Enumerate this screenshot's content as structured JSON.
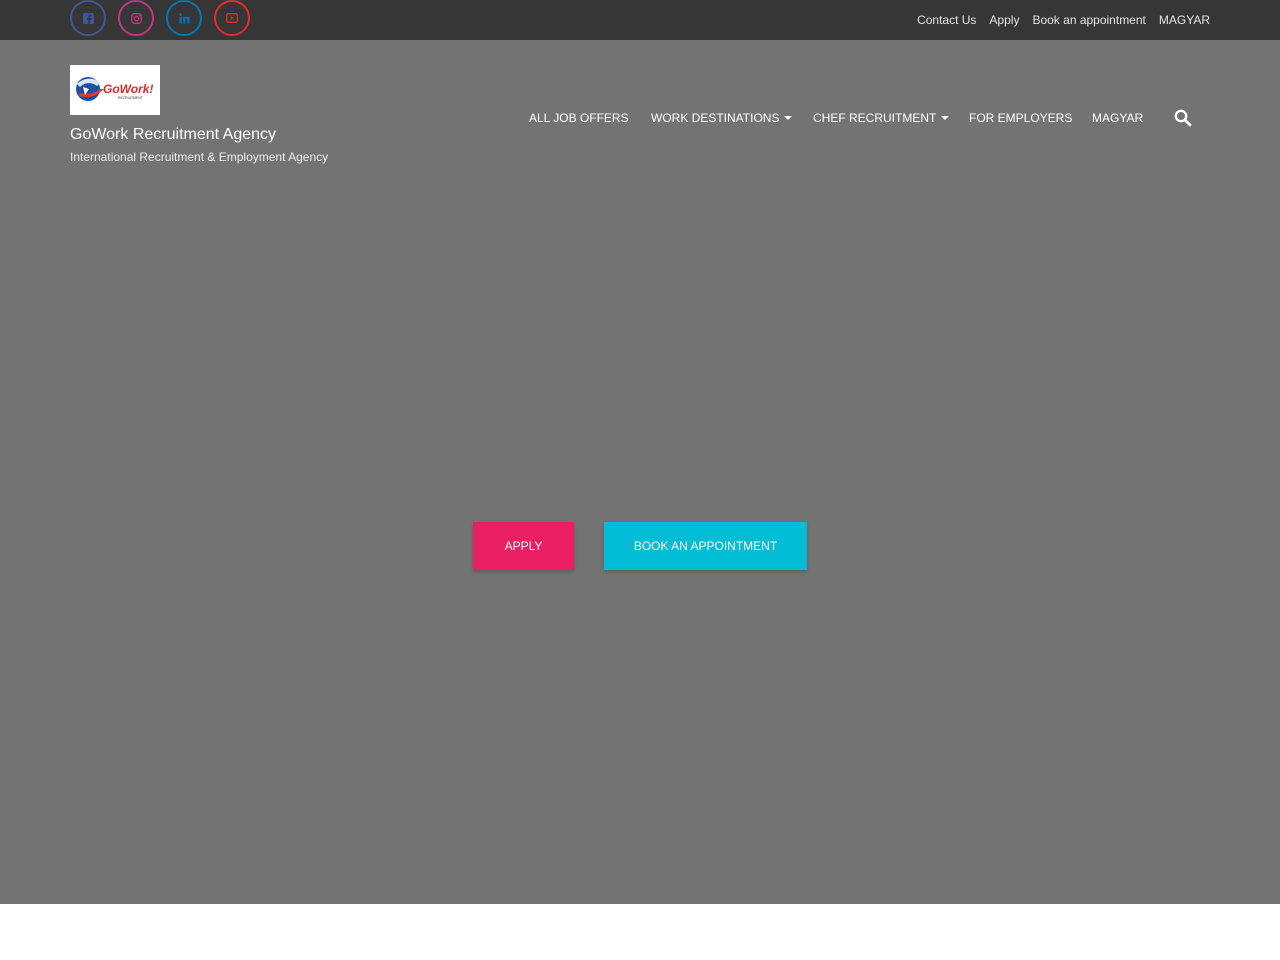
{
  "social": [
    {
      "name": "facebook-icon",
      "color": "#3b5998"
    },
    {
      "name": "instagram-icon",
      "color": "#c13584"
    },
    {
      "name": "linkedin-icon",
      "color": "#0077b5"
    },
    {
      "name": "youtube-icon",
      "color": "#e52d27"
    }
  ],
  "top_links": [
    "Contact Us",
    "Apply",
    "Book an appointment",
    "MAGYAR"
  ],
  "brand": {
    "logo_icon": "gowork-logo",
    "title": "GoWork Recruitment Agency",
    "tagline": "International Recruitment & Employment Agency"
  },
  "nav": {
    "all_jobs": "ALL JOB OFFERS",
    "destinations": "WORK DESTINATIONS",
    "chef": "CHEF RECRUITMENT",
    "employers": "FOR EMPLOYERS",
    "magyar": "MAGYAR",
    "search_icon": "search-icon"
  },
  "hero": {
    "apply_label": "APPLY",
    "book_label": "BOOK AN APPOINTMENT"
  },
  "colors": {
    "topbar": "#363636",
    "hero_overlay": "#737373",
    "apply": "#e91e63",
    "book": "#00bcd4"
  }
}
